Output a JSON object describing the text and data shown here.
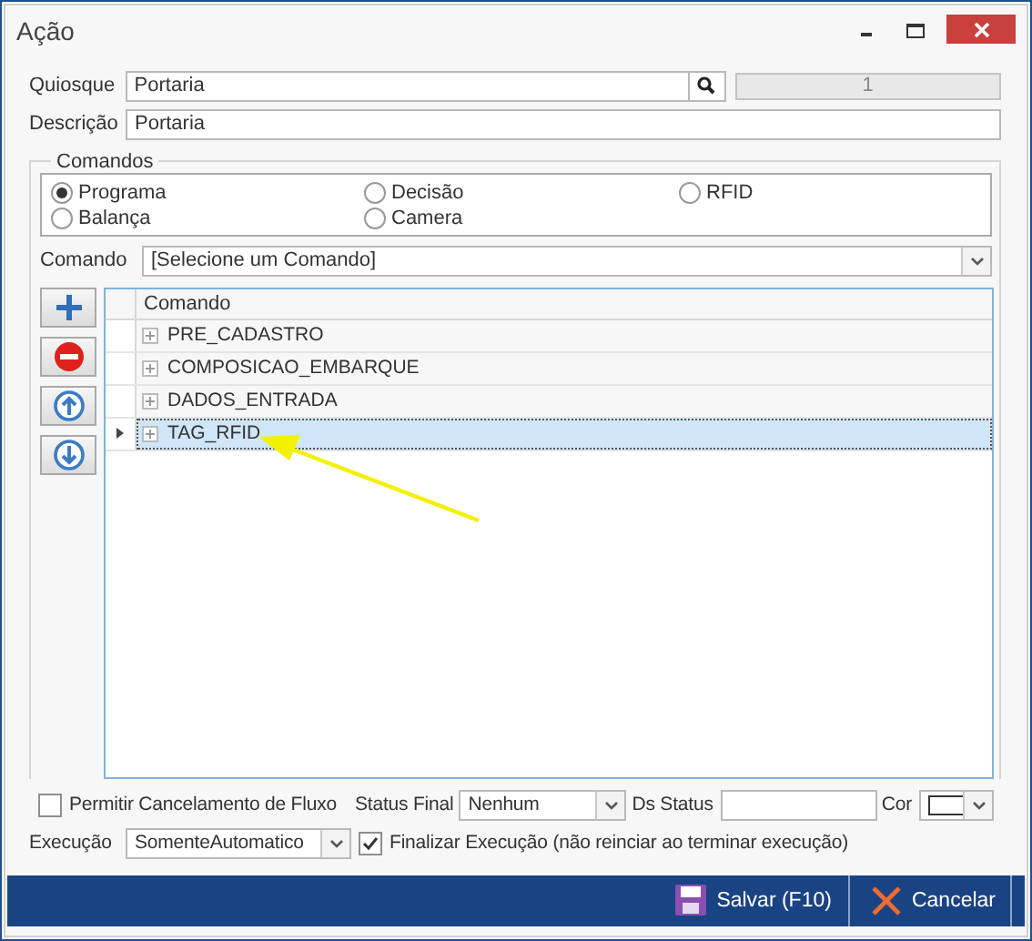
{
  "window": {
    "title": "Ação"
  },
  "quiosque": {
    "label": "Quiosque",
    "value": "Portaria",
    "code": "1"
  },
  "descricao": {
    "label": "Descrição",
    "value": "Portaria"
  },
  "comandos_group": {
    "title": "Comandos",
    "options": [
      {
        "label": "Programa",
        "selected": true
      },
      {
        "label": "Decisão",
        "selected": false
      },
      {
        "label": "RFID",
        "selected": false
      },
      {
        "label": "Balança",
        "selected": false
      },
      {
        "label": "Camera",
        "selected": false
      }
    ]
  },
  "comando": {
    "label": "Comando",
    "value": "[Selecione um Comando]"
  },
  "grid": {
    "columns": [
      "Comando"
    ],
    "rows": [
      {
        "name": "PRE_CADASTRO",
        "selected": false
      },
      {
        "name": "COMPOSICAO_EMBARQUE",
        "selected": false
      },
      {
        "name": "DADOS_ENTRADA",
        "selected": false
      },
      {
        "name": "TAG_RFID",
        "selected": true
      }
    ]
  },
  "permitir": {
    "label": "Permitir Cancelamento de Fluxo",
    "checked": false
  },
  "status_final": {
    "label": "Status Final",
    "value": "Nenhum"
  },
  "ds_status": {
    "label": "Ds Status"
  },
  "cor": {
    "label": "Cor"
  },
  "execucao": {
    "label": "Execução",
    "value": "SomenteAutomatico"
  },
  "finalizar": {
    "label": "Finalizar Execução (não reinciar ao terminar execução)",
    "checked": true
  },
  "buttons": [
    {
      "label": "Salvar (F10)",
      "kind": "save"
    },
    {
      "label": "Cancelar",
      "kind": "cancel"
    }
  ]
}
